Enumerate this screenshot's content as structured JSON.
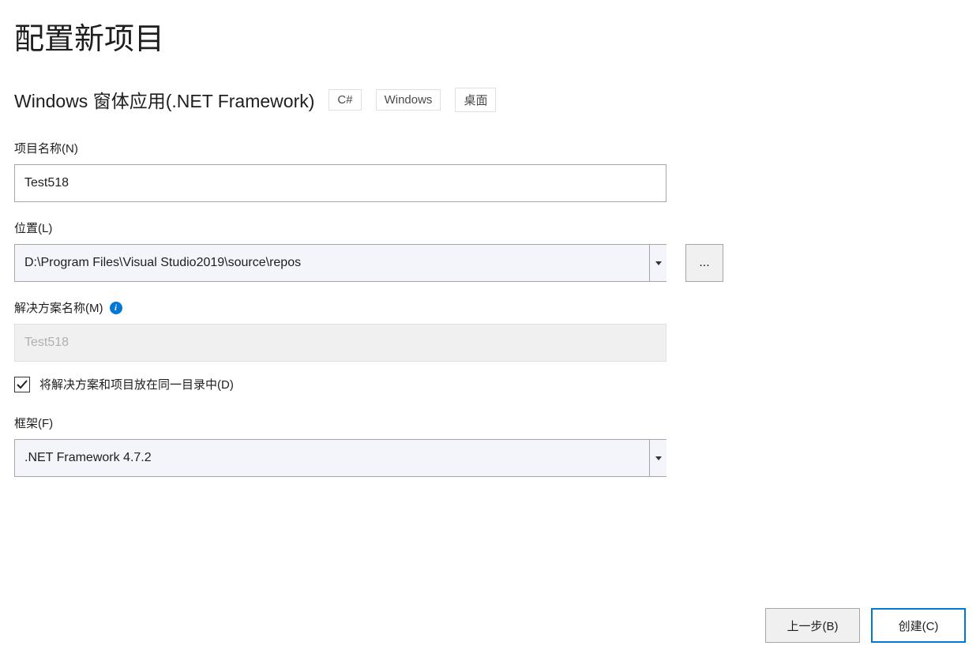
{
  "title": "配置新项目",
  "template": {
    "name": "Windows 窗体应用(.NET Framework)",
    "tags": [
      "C#",
      "Windows",
      "桌面"
    ]
  },
  "fields": {
    "projectName": {
      "label": "项目名称(N)",
      "value": "Test518"
    },
    "location": {
      "label": "位置(L)",
      "value": "D:\\Program Files\\Visual Studio2019\\source\\repos",
      "browseLabel": "..."
    },
    "solutionName": {
      "label": "解决方案名称(M)",
      "value": "Test518"
    },
    "sameDirectory": {
      "label": "将解决方案和项目放在同一目录中(D)",
      "checked": true
    },
    "framework": {
      "label": "框架(F)",
      "value": ".NET Framework 4.7.2"
    }
  },
  "buttons": {
    "back": "上一步(B)",
    "create": "创建(C)"
  }
}
